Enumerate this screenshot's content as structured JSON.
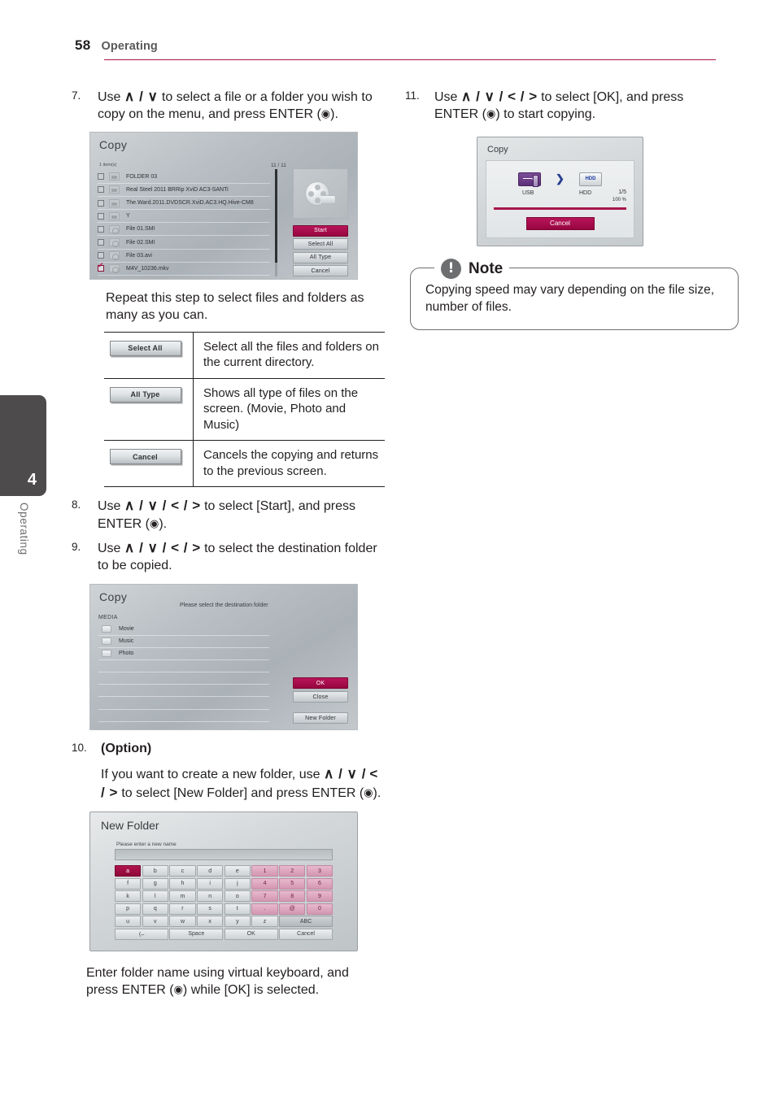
{
  "header": {
    "page_number": "58",
    "section": "Operating"
  },
  "side_tab": {
    "number": "4",
    "label": "Operating"
  },
  "steps": {
    "s7": {
      "num": "7.",
      "text_a": "Use ",
      "arrows": "∧ / ∨",
      "text_b": " to select a file or a folder you wish to copy on the menu, and press ENTER (",
      "enter_icon": "◉",
      "text_c": ")."
    },
    "repeat": "Repeat this step to select files and folders as many as you can.",
    "s8": {
      "num": "8.",
      "text_a": "Use ",
      "arrows": "∧ / ∨ / < / >",
      "text_b": " to select [Start], and press ENTER (",
      "enter_icon": "◉",
      "text_c": ")."
    },
    "s9": {
      "num": "9.",
      "text_a": "Use ",
      "arrows": "∧ / ∨ / < / >",
      "text_b": " to select the destination folder to be copied."
    },
    "s10": {
      "num": "10.",
      "heading": "(Option)",
      "text_a": "If you want to create a new folder, use ",
      "arrows_a": "∧ / ∨ /",
      "arrows_b": "< / >",
      "text_b": " to select [New Folder] and press ENTER (",
      "enter_icon": "◉",
      "text_c": ")."
    },
    "after10": {
      "text_a": "Enter folder name using virtual keyboard, and press ENTER (",
      "enter_icon": "◉",
      "text_b": ") while [OK] is selected."
    },
    "s11": {
      "num": "11.",
      "text_a": "Use ",
      "arrows": "∧ / ∨ / < / >",
      "text_b": " to select [OK], and press ENTER (",
      "enter_icon": "◉",
      "text_c": ") to start copying."
    }
  },
  "copy_list_dialog": {
    "title": "Copy",
    "item_count": "1 item(s)",
    "pagination": "11 / 11",
    "rows": [
      {
        "name": "FOLDER 03",
        "type": "folder",
        "checked": false
      },
      {
        "name": "Real Steel 2011 BRRip XviD AC3-SANTi",
        "type": "folder",
        "checked": false
      },
      {
        "name": "The.Ward.2011.DVDSCR.XviD.AC3.HQ.Hive-CM8",
        "type": "folder",
        "checked": false
      },
      {
        "name": "Y",
        "type": "folder",
        "checked": false
      },
      {
        "name": "File 01.SMI",
        "type": "disc",
        "checked": false
      },
      {
        "name": "File 02.SMI",
        "type": "disc",
        "checked": false
      },
      {
        "name": "File 03.avi",
        "type": "disc",
        "checked": false
      },
      {
        "name": "M4V_10236.mkv",
        "type": "disc",
        "checked": true
      }
    ],
    "buttons": [
      {
        "label": "Start",
        "accent": true
      },
      {
        "label": "Select All",
        "accent": false
      },
      {
        "label": "All Type",
        "accent": false
      },
      {
        "label": "Cancel",
        "accent": false
      }
    ],
    "preview_icon": "film-reel-icon"
  },
  "button_table": {
    "rows": [
      {
        "button": "Select All",
        "description": "Select all the files and folders on the current directory."
      },
      {
        "button": "All Type",
        "description": "Shows all type of files on the screen. (Movie, Photo and Music)"
      },
      {
        "button": "Cancel",
        "description": "Cancels the copying and returns to the previous screen."
      }
    ]
  },
  "copy_dest_dialog": {
    "title": "Copy",
    "subtitle": "Please select the destination folder",
    "group_label": "MEDIA",
    "folders": [
      "Movie",
      "Music",
      "Photo"
    ],
    "buttons": [
      {
        "label": "OK",
        "accent": true
      },
      {
        "label": "Close",
        "accent": false
      },
      {
        "label": "New Folder",
        "accent": false
      }
    ]
  },
  "new_folder_dialog": {
    "title": "New Folder",
    "prompt": "Please enter a new name",
    "input_value": "",
    "keyboard_rows": [
      [
        {
          "k": "a",
          "t": "sel"
        },
        {
          "k": "b",
          "t": "c"
        },
        {
          "k": "c",
          "t": "c"
        },
        {
          "k": "d",
          "t": "c"
        },
        {
          "k": "e",
          "t": "c"
        },
        {
          "k": "1",
          "t": "num"
        },
        {
          "k": "2",
          "t": "num"
        },
        {
          "k": "3",
          "t": "num"
        }
      ],
      [
        {
          "k": "f",
          "t": "c"
        },
        {
          "k": "g",
          "t": "c"
        },
        {
          "k": "h",
          "t": "c"
        },
        {
          "k": "i",
          "t": "c"
        },
        {
          "k": "j",
          "t": "c"
        },
        {
          "k": "4",
          "t": "num"
        },
        {
          "k": "5",
          "t": "num"
        },
        {
          "k": "6",
          "t": "num"
        }
      ],
      [
        {
          "k": "k",
          "t": "c"
        },
        {
          "k": "l",
          "t": "c"
        },
        {
          "k": "m",
          "t": "c"
        },
        {
          "k": "n",
          "t": "c"
        },
        {
          "k": "o",
          "t": "c"
        },
        {
          "k": "7",
          "t": "num"
        },
        {
          "k": "8",
          "t": "num"
        },
        {
          "k": "9",
          "t": "num"
        }
      ],
      [
        {
          "k": "p",
          "t": "c"
        },
        {
          "k": "q",
          "t": "c"
        },
        {
          "k": "r",
          "t": "c"
        },
        {
          "k": "s",
          "t": "c"
        },
        {
          "k": "t",
          "t": "c"
        },
        {
          "k": ".",
          "t": "num"
        },
        {
          "k": "@",
          "t": "num"
        },
        {
          "k": "0",
          "t": "num"
        }
      ],
      [
        {
          "k": "u",
          "t": "c"
        },
        {
          "k": "v",
          "t": "c"
        },
        {
          "k": "w",
          "t": "c"
        },
        {
          "k": "x",
          "t": "c"
        },
        {
          "k": "y",
          "t": "c"
        },
        {
          "k": "z",
          "t": "c"
        },
        {
          "k": "ABC",
          "t": "abc"
        }
      ],
      [
        {
          "k": "⟨–",
          "t": "wide"
        },
        {
          "k": "Space",
          "t": "wide"
        },
        {
          "k": "OK",
          "t": "wide"
        },
        {
          "k": "Cancel",
          "t": "wide"
        }
      ]
    ]
  },
  "progress_dialog": {
    "title": "Copy",
    "source_label": "USB",
    "dest_label": "HDD",
    "count": "1/5",
    "percent": "100 %",
    "progress_value": 100,
    "cancel_label": "Cancel",
    "source_icon": "usb-icon",
    "dest_icon": "hdd-icon",
    "arrow_icon": "chevron-right-icon"
  },
  "note": {
    "icon": "!",
    "title": "Note",
    "body": "Copying speed may vary depending on the file size, number of files."
  },
  "colors": {
    "accent": "#a8154b",
    "tab_gray": "#4d4b4c",
    "text": "#231f20",
    "muted": "#6d6e70"
  }
}
